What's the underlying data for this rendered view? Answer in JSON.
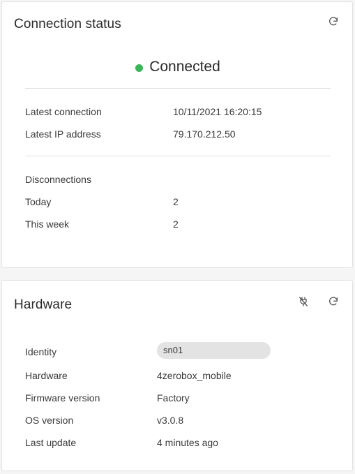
{
  "connection": {
    "title": "Connection status",
    "refresh_icon": "refresh-icon",
    "status": "Connected",
    "status_color": "#3cb55a",
    "latest_connection_label": "Latest connection",
    "latest_connection_value": "10/11/2021 16:20:15",
    "latest_ip_label": "Latest IP address",
    "latest_ip_value": "79.170.212.50",
    "disconnections_heading": "Disconnections",
    "today_label": "Today",
    "today_value": "2",
    "week_label": "This week",
    "week_value": "2"
  },
  "hardware": {
    "title": "Hardware",
    "unplug_icon": "unplug-icon",
    "refresh_icon": "refresh-icon",
    "identity_label": "Identity",
    "identity_value": "sn01",
    "hardware_label": "Hardware",
    "hardware_value": "4zerobox_mobile",
    "firmware_label": "Firmware version",
    "firmware_value": "Factory",
    "os_label": "OS version",
    "os_value": "v3.0.8",
    "last_update_label": "Last update",
    "last_update_value": "4 minutes ago"
  }
}
